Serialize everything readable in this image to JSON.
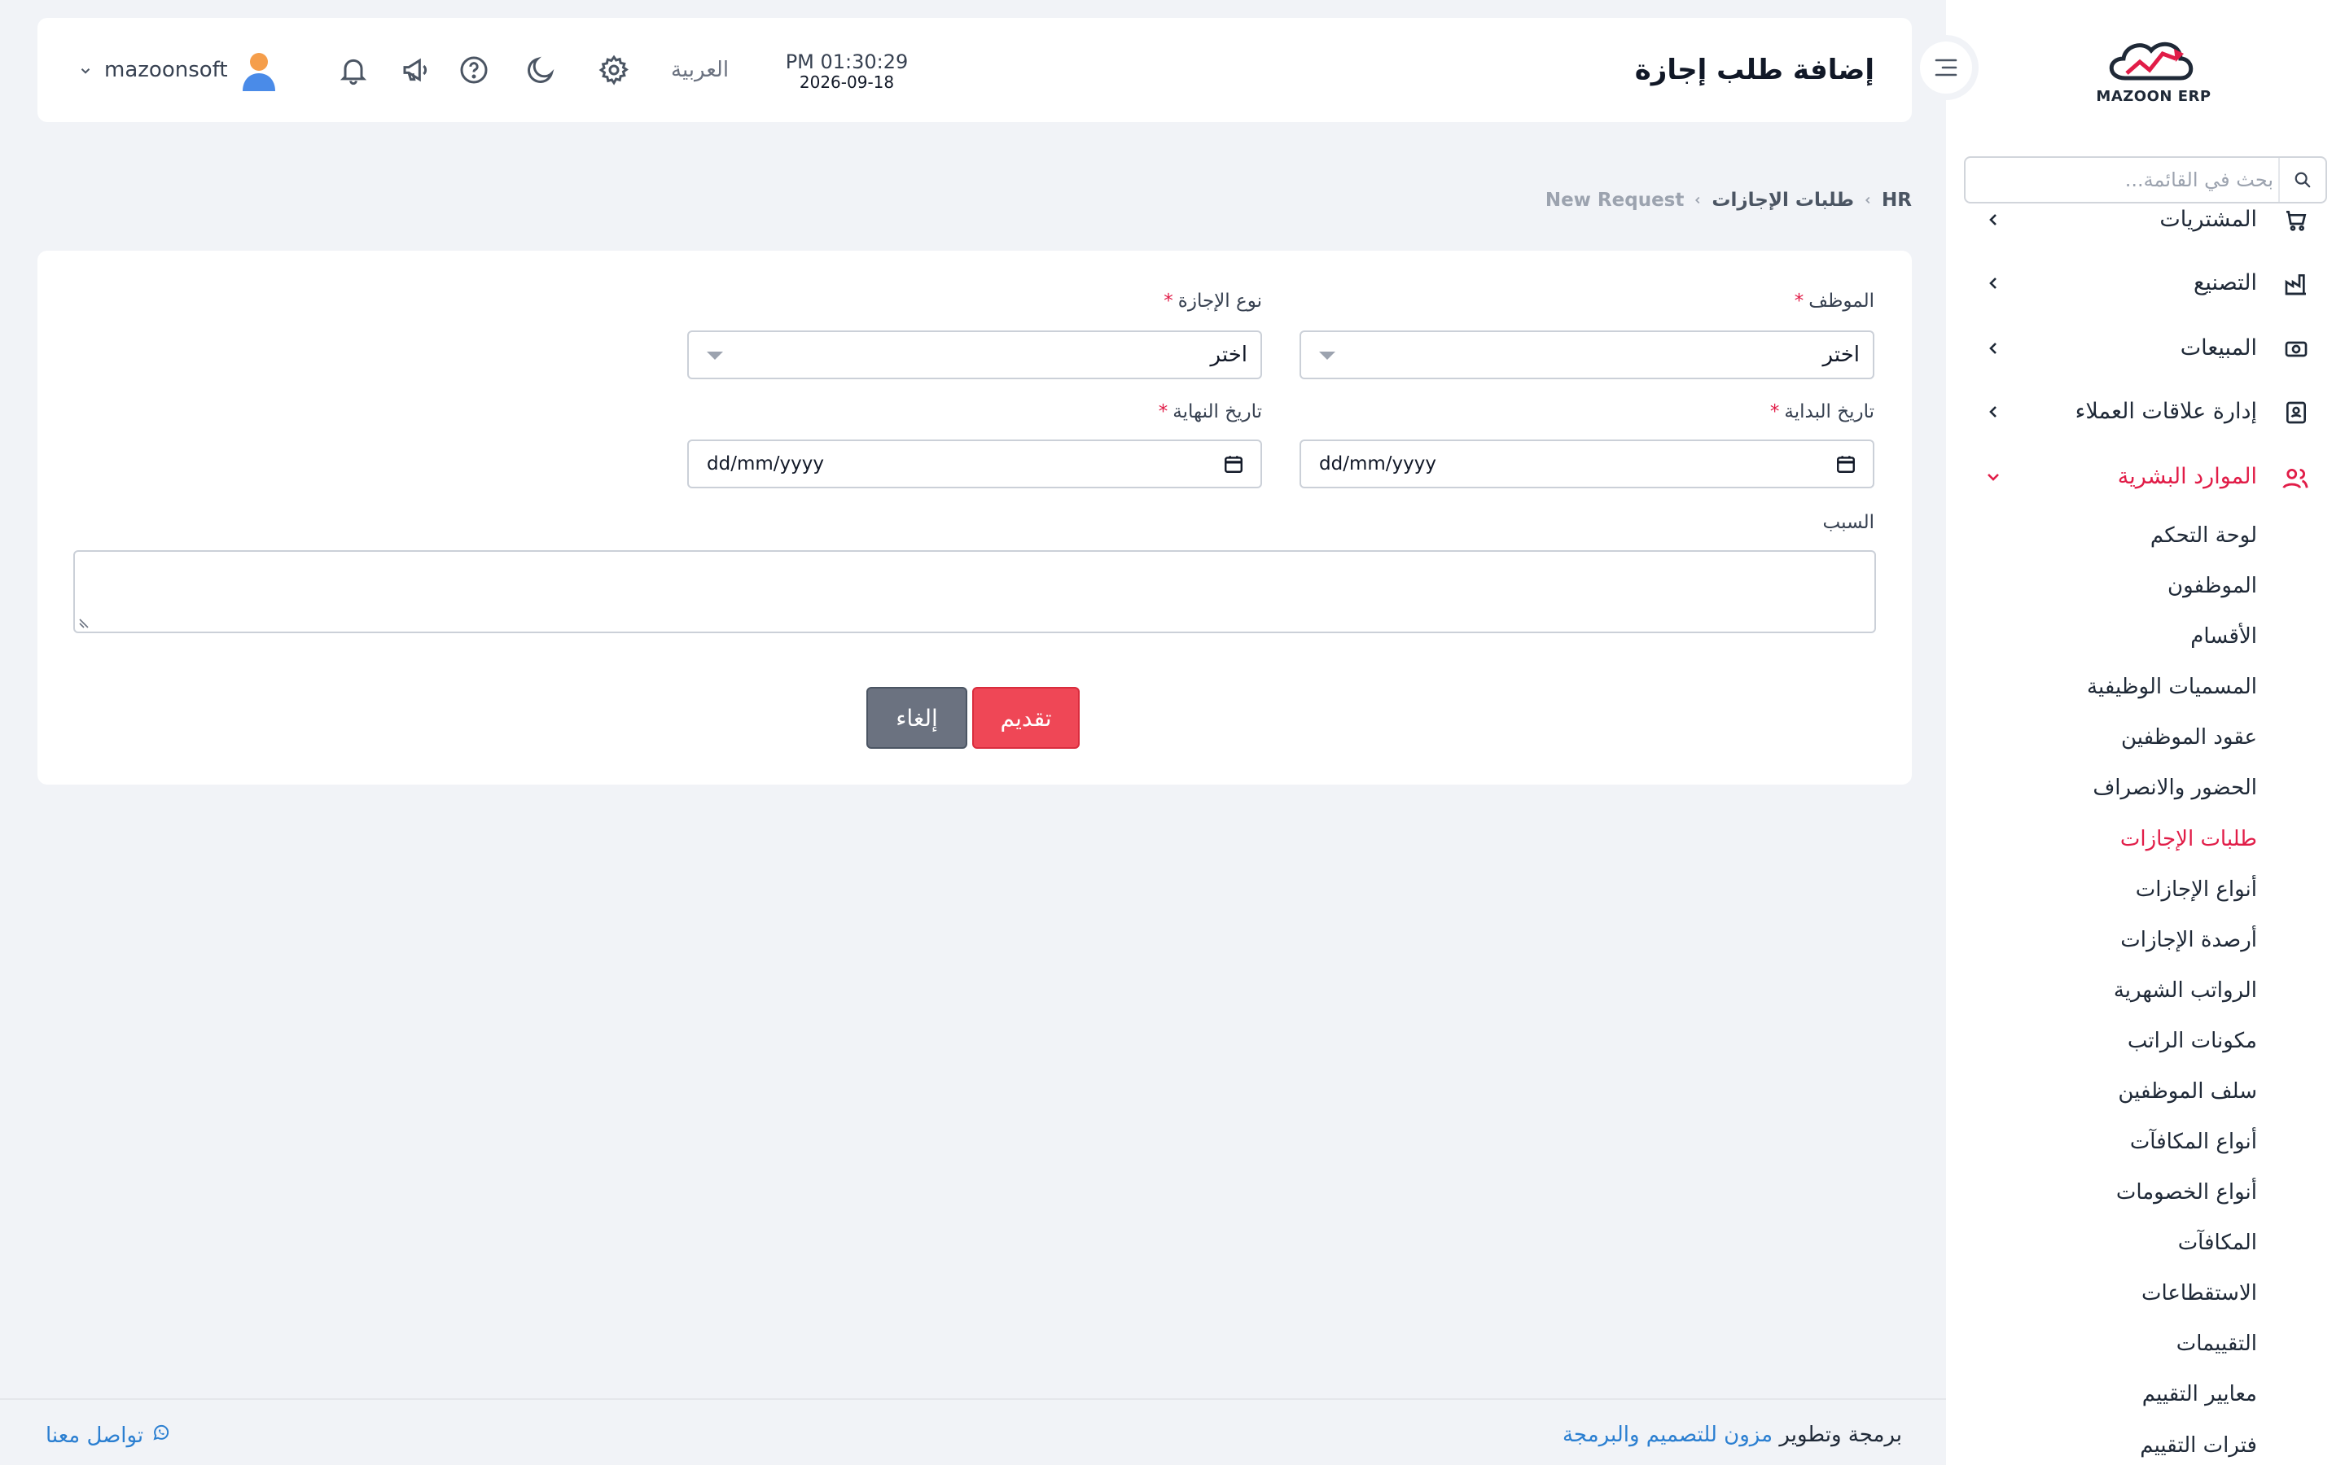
{
  "sidebar": {
    "logo_text": "MAZOON ERP",
    "search_placeholder": "بحث في القائمة...",
    "menu": [
      {
        "label": "المشتريات",
        "icon": "cart-icon"
      },
      {
        "label": "التصنيع",
        "icon": "factory-icon"
      },
      {
        "label": "المبيعات",
        "icon": "cash-icon"
      },
      {
        "label": "إدارة علاقات العملاء",
        "icon": "contact-card-icon"
      },
      {
        "label": "الموارد البشرية",
        "icon": "users-icon"
      }
    ],
    "hr_items": [
      "لوحة التحكم",
      "الموظفون",
      "الأقسام",
      "المسميات الوظيفية",
      "عقود الموظفين",
      "الحضور والانصراف",
      "طلبات الإجازات",
      "أنواع الإجازات",
      "أرصدة الإجازات",
      "الرواتب الشهرية",
      "مكونات الراتب",
      "سلف الموظفين",
      "أنواع المكافآت",
      "أنواع الخصومات",
      "المكافآت",
      "الاستقطاعات",
      "التقييمات",
      "معايير التقييم",
      "فترات التقييم"
    ]
  },
  "header": {
    "title": "إضافة طلب إجازة",
    "time": "PM 01:30:29",
    "date": "2026-09-18",
    "language": "العربية",
    "username": "mazoonsoft"
  },
  "breadcrumb": [
    "HR",
    "طلبات الإجازات",
    "New Request"
  ],
  "form": {
    "employee_label": "الموظف",
    "employee_value": "اختر",
    "leave_type_label": "نوع الإجازة",
    "leave_type_value": "اختر",
    "start_label": "تاريخ البداية",
    "end_label": "تاريخ النهاية",
    "date_placeholder": "dd/mm/yyyy",
    "reason_label": "السبب",
    "required_mark": "*",
    "submit_label": "تقديم",
    "cancel_label": "إلغاء"
  },
  "footer": {
    "credit_plain": "برمجة وتطوير",
    "credit_link": "مزون للتصميم والبرمجة",
    "contact": "تواصل معنا"
  },
  "colors": {
    "accent": "#e11d48",
    "link": "#2b7fd1",
    "submit": "#ef4756",
    "cancel": "#6b7280"
  }
}
